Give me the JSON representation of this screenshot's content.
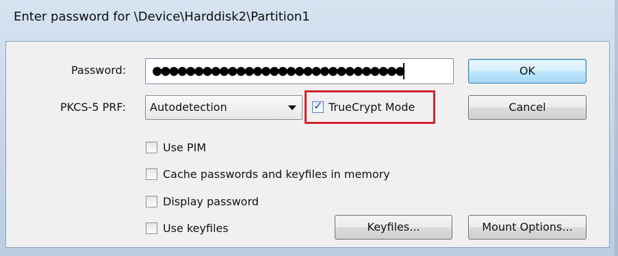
{
  "window": {
    "title": "Enter password for \\Device\\Harddisk2\\Partition1"
  },
  "password": {
    "label": "Password:",
    "masked_value": "●●●●●●●●●●●●●●●●●●●●●●●●●●●●●●"
  },
  "prf": {
    "label": "PKCS-5 PRF:",
    "selected": "Autodetection"
  },
  "options": {
    "truecrypt_mode": {
      "label": "TrueCrypt Mode",
      "checked": true
    },
    "use_pim": {
      "label": "Use PIM",
      "checked": false
    },
    "cache": {
      "label": "Cache passwords and keyfiles in memory",
      "checked": false
    },
    "display_password": {
      "label": "Display password",
      "checked": false
    },
    "use_keyfiles": {
      "label": "Use keyfiles",
      "checked": false
    }
  },
  "buttons": {
    "ok": "OK",
    "cancel": "Cancel",
    "keyfiles": "Keyfiles...",
    "mount_options": "Mount Options..."
  },
  "colors": {
    "highlight_box": "#d0212b",
    "default_button": "#bee6fd"
  }
}
